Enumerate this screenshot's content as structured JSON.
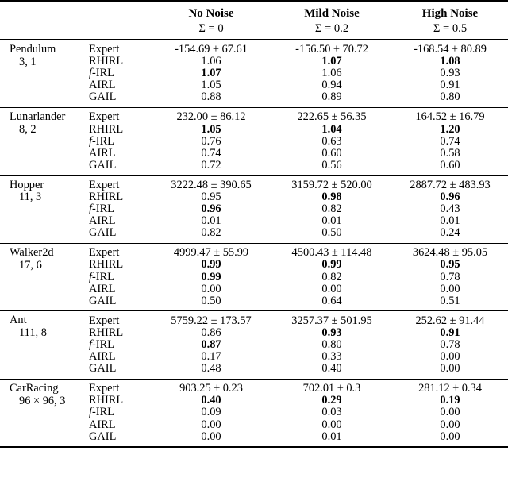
{
  "table": {
    "header": {
      "env_col_label": "",
      "method_col_label": "",
      "groups": [
        {
          "title": "No Noise",
          "subtitle": "Σ = 0"
        },
        {
          "title": "Mild Noise",
          "subtitle": "Σ = 0.2"
        },
        {
          "title": "High Noise",
          "subtitle": "Σ = 0.5"
        }
      ]
    },
    "sections": [
      {
        "env_name": "Pendulum",
        "env_dims": "3, 1",
        "rows": [
          {
            "method": "Expert",
            "method_italic_prefix": "",
            "values": [
              "-154.69 ± 67.61",
              "-156.50 ± 70.72",
              "-168.54 ± 80.89"
            ],
            "bold": [
              false,
              false,
              false
            ]
          },
          {
            "method": "RHIRL",
            "method_italic_prefix": "",
            "values": [
              "1.06",
              "1.07",
              "1.08"
            ],
            "bold": [
              false,
              true,
              true
            ]
          },
          {
            "method": "-IRL",
            "method_italic_prefix": "f",
            "values": [
              "1.07",
              "1.06",
              "0.93"
            ],
            "bold": [
              true,
              false,
              false
            ]
          },
          {
            "method": "AIRL",
            "method_italic_prefix": "",
            "values": [
              "1.05",
              "0.94",
              "0.91"
            ],
            "bold": [
              false,
              false,
              false
            ]
          },
          {
            "method": "GAIL",
            "method_italic_prefix": "",
            "values": [
              "0.88",
              "0.89",
              "0.80"
            ],
            "bold": [
              false,
              false,
              false
            ]
          }
        ]
      },
      {
        "env_name": "Lunarlander",
        "env_dims": "8, 2",
        "rows": [
          {
            "method": "Expert",
            "method_italic_prefix": "",
            "values": [
              "232.00 ± 86.12",
              "222.65 ± 56.35",
              "164.52 ± 16.79"
            ],
            "bold": [
              false,
              false,
              false
            ]
          },
          {
            "method": "RHIRL",
            "method_italic_prefix": "",
            "values": [
              "1.05",
              "1.04",
              "1.20"
            ],
            "bold": [
              true,
              true,
              true
            ]
          },
          {
            "method": "-IRL",
            "method_italic_prefix": "f",
            "values": [
              "0.76",
              "0.63",
              "0.74"
            ],
            "bold": [
              false,
              false,
              false
            ]
          },
          {
            "method": "AIRL",
            "method_italic_prefix": "",
            "values": [
              "0.74",
              "0.60",
              "0.58"
            ],
            "bold": [
              false,
              false,
              false
            ]
          },
          {
            "method": "GAIL",
            "method_italic_prefix": "",
            "values": [
              "0.72",
              "0.56",
              "0.60"
            ],
            "bold": [
              false,
              false,
              false
            ]
          }
        ]
      },
      {
        "env_name": "Hopper",
        "env_dims": "11, 3",
        "rows": [
          {
            "method": "Expert",
            "method_italic_prefix": "",
            "values": [
              "3222.48 ± 390.65",
              "3159.72 ± 520.00",
              "2887.72 ± 483.93"
            ],
            "bold": [
              false,
              false,
              false
            ]
          },
          {
            "method": "RHIRL",
            "method_italic_prefix": "",
            "values": [
              "0.95",
              "0.98",
              "0.96"
            ],
            "bold": [
              false,
              true,
              true
            ]
          },
          {
            "method": "-IRL",
            "method_italic_prefix": "f",
            "values": [
              "0.96",
              "0.82",
              "0.43"
            ],
            "bold": [
              true,
              false,
              false
            ]
          },
          {
            "method": "AIRL",
            "method_italic_prefix": "",
            "values": [
              "0.01",
              "0.01",
              "0.01"
            ],
            "bold": [
              false,
              false,
              false
            ]
          },
          {
            "method": "GAIL",
            "method_italic_prefix": "",
            "values": [
              "0.82",
              "0.50",
              "0.24"
            ],
            "bold": [
              false,
              false,
              false
            ]
          }
        ]
      },
      {
        "env_name": "Walker2d",
        "env_dims": "17, 6",
        "rows": [
          {
            "method": "Expert",
            "method_italic_prefix": "",
            "values": [
              "4999.47 ± 55.99",
              "4500.43 ± 114.48",
              "3624.48 ± 95.05"
            ],
            "bold": [
              false,
              false,
              false
            ]
          },
          {
            "method": "RHIRL",
            "method_italic_prefix": "",
            "values": [
              "0.99",
              "0.99",
              "0.95"
            ],
            "bold": [
              true,
              true,
              true
            ]
          },
          {
            "method": "-IRL",
            "method_italic_prefix": "f",
            "values": [
              "0.99",
              "0.82",
              "0.78"
            ],
            "bold": [
              true,
              false,
              false
            ]
          },
          {
            "method": "AIRL",
            "method_italic_prefix": "",
            "values": [
              "0.00",
              "0.00",
              "0.00"
            ],
            "bold": [
              false,
              false,
              false
            ]
          },
          {
            "method": "GAIL",
            "method_italic_prefix": "",
            "values": [
              "0.50",
              "0.64",
              "0.51"
            ],
            "bold": [
              false,
              false,
              false
            ]
          }
        ]
      },
      {
        "env_name": "Ant",
        "env_dims": "111, 8",
        "rows": [
          {
            "method": "Expert",
            "method_italic_prefix": "",
            "values": [
              "5759.22 ± 173.57",
              "3257.37 ± 501.95",
              "252.62 ± 91.44"
            ],
            "bold": [
              false,
              false,
              false
            ]
          },
          {
            "method": "RHIRL",
            "method_italic_prefix": "",
            "values": [
              "0.86",
              "0.93",
              "0.91"
            ],
            "bold": [
              false,
              true,
              true
            ]
          },
          {
            "method": "-IRL",
            "method_italic_prefix": "f",
            "values": [
              "0.87",
              "0.80",
              "0.78"
            ],
            "bold": [
              true,
              false,
              false
            ]
          },
          {
            "method": "AIRL",
            "method_italic_prefix": "",
            "values": [
              "0.17",
              "0.33",
              "0.00"
            ],
            "bold": [
              false,
              false,
              false
            ]
          },
          {
            "method": "GAIL",
            "method_italic_prefix": "",
            "values": [
              "0.48",
              "0.40",
              "0.00"
            ],
            "bold": [
              false,
              false,
              false
            ]
          }
        ]
      },
      {
        "env_name": "CarRacing",
        "env_dims": "96 × 96, 3",
        "rows": [
          {
            "method": "Expert",
            "method_italic_prefix": "",
            "values": [
              "903.25 ± 0.23",
              "702.01 ± 0.3",
              "281.12 ± 0.34"
            ],
            "bold": [
              false,
              false,
              false
            ]
          },
          {
            "method": "RHIRL",
            "method_italic_prefix": "",
            "values": [
              "0.40",
              "0.29",
              "0.19"
            ],
            "bold": [
              true,
              true,
              true
            ]
          },
          {
            "method": "-IRL",
            "method_italic_prefix": "f",
            "values": [
              "0.09",
              "0.03",
              "0.00"
            ],
            "bold": [
              false,
              false,
              false
            ]
          },
          {
            "method": "AIRL",
            "method_italic_prefix": "",
            "values": [
              "0.00",
              "0.00",
              "0.00"
            ],
            "bold": [
              false,
              false,
              false
            ]
          },
          {
            "method": "GAIL",
            "method_italic_prefix": "",
            "values": [
              "0.00",
              "0.01",
              "0.00"
            ],
            "bold": [
              false,
              false,
              false
            ]
          }
        ]
      }
    ]
  }
}
